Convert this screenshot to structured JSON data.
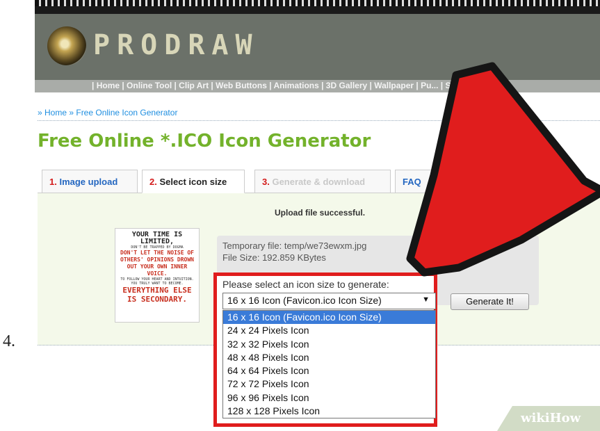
{
  "step_number": "4.",
  "site": {
    "logo_text": "PRODRAW",
    "nav": "| Home | Online Tool | Clip Art | Web Buttons | Animations | 3D Gallery | Wallpaper | Pu... | Sp"
  },
  "breadcrumb": "» Home » Free Online Icon Generator",
  "page_title": "Free Online *.ICO Icon Generator",
  "tabs": [
    {
      "num": "1.",
      "label": "Image upload"
    },
    {
      "num": "2.",
      "label": "Select icon size"
    },
    {
      "num": "3.",
      "label": "Generate & download"
    },
    {
      "num": "",
      "label": "FAQ"
    }
  ],
  "upload_status": "Upload file successful.",
  "poster_lines": {
    "l1": "YOUR TIME IS LIMITED,",
    "l2": "DON'T BE TRAPPED BY DOGMA",
    "l3": "DON'T LET THE NOISE OF",
    "l4": "OTHERS' OPINIONS DROWN",
    "l5": "OUT YOUR OWN INNER VOICE.",
    "l6": "TO FOLLOW YOUR HEART AND INTUITION.",
    "l7": "YOU TRULY WANT TO BECOME.",
    "l8": "EVERYTHING ELSE",
    "l9": "IS SECONDARY."
  },
  "file": {
    "temp_line": "Temporary file: temp/we73ewxm.jpg",
    "size_line": "File Size: 192.859 KBytes"
  },
  "size_select": {
    "prompt": "Please select an icon size to generate:",
    "selected": "16 x 16 Icon (Favicon.ico Icon Size)",
    "options": [
      "16 x 16 Icon (Favicon.ico Icon Size)",
      "24 x 24 Pixels Icon",
      "32 x 32 Pixels Icon",
      "48 x 48 Pixels Icon",
      "64 x 64 Pixels Icon",
      "72 x 72 Pixels Icon",
      "96 x 96 Pixels Icon",
      "128 x 128 Pixels Icon"
    ]
  },
  "generate_button": "Generate It!",
  "watermark": "wikiHow",
  "colors": {
    "title_green": "#73b22b",
    "highlight_red": "#e01d1d",
    "selected_option": "#3a7bd8",
    "link_blue": "#1e8ee0"
  }
}
